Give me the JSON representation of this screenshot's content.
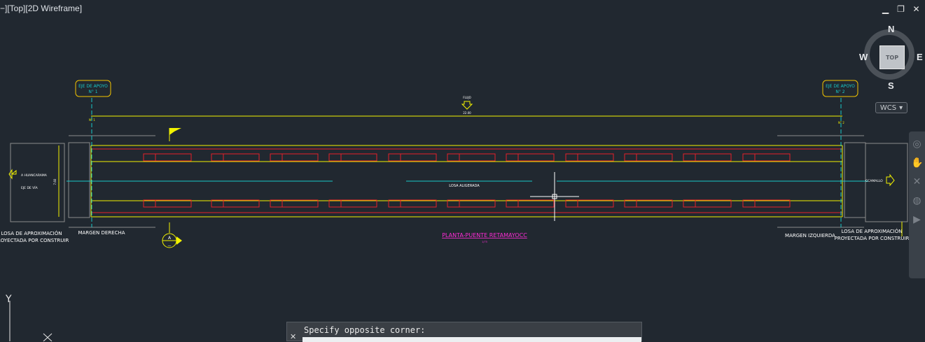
{
  "viewport": {
    "label": "−][Top][2D Wireframe]"
  },
  "window_controls": {
    "minimize": "▁",
    "restore": "❐",
    "close": "✕"
  },
  "viewcube": {
    "face": "TOP",
    "north": "N",
    "south": "S",
    "east": "E",
    "west": "W"
  },
  "wcs": {
    "label": "WCS",
    "arrow": "▾"
  },
  "drawing": {
    "axis_left": {
      "line1": "EJE DE APOYO",
      "line2": "N° 1"
    },
    "axis_right": {
      "line1": "EJE DE APOYO",
      "line2": "N° 2"
    },
    "flow_label": "FLUJO",
    "span_dim": "22.00",
    "left_to": "A HUANCARAMA",
    "left_axis": "EJE DE VÍA",
    "left_width": "7.60",
    "right_to": "CCAMALLO",
    "slab": "LOSA ALIGERADA",
    "title": "PLANTA-PUENTE RETAMAYOCC",
    "scale": "1/75",
    "section_mark": "A",
    "section_sub": "—",
    "left_bank": "MARGEN DERECHA",
    "right_bank": "MARGEN IZQUIERDA",
    "left_slab_l1": "LOSA DE APROXIMACIÓN",
    "left_slab_l2": "PROYECTADA  POR CONSTRUIR",
    "right_slab_l1": "LOSA DE APROXIMACIÓN",
    "right_slab_l2": "PROYECTADA POR CONSTRUIR"
  },
  "ucs": {
    "y": "Y"
  },
  "command": {
    "prompt": "Specify opposite corner:",
    "close": "✕"
  },
  "colors": {
    "background": "#212830",
    "yellow": "#f2f200",
    "red": "#e5202a",
    "cyan": "#19c8c8",
    "magenta": "#ff2bd6",
    "gray": "#8c8c8c"
  }
}
